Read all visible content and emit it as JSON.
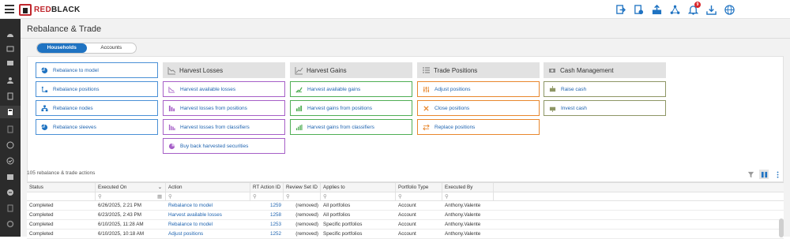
{
  "app": {
    "brand_red": "RED",
    "brand_black": "BLACK",
    "title": "Rebalance & Trade"
  },
  "top_icons": [
    "trade-icon",
    "reports-icon",
    "upload-icon",
    "network-icon",
    "bell-icon",
    "download-icon",
    "globe-icon"
  ],
  "notifications_count": "9",
  "left_nav": [
    "dashboard-icon",
    "portfolio-icon",
    "household-icon",
    "users-icon",
    "rebalance-icon",
    "document-icon",
    "model-icon",
    "check-icon",
    "calendar-icon",
    "minus-circle-icon",
    "file-icon",
    "settings-icon"
  ],
  "toggle": {
    "households": "Households",
    "accounts": "Accounts"
  },
  "groups": {
    "rebalance": {
      "items": [
        "Rebalance to model",
        "Rebalance positions",
        "Rebalance nodes",
        "Rebalance sleeves"
      ]
    },
    "harvest_losses": {
      "title": "Harvest Losses",
      "items": [
        "Harvest available losses",
        "Harvest losses from positions",
        "Harvest losses from classifiers",
        "Buy back harvested securities"
      ]
    },
    "harvest_gains": {
      "title": "Harvest Gains",
      "items": [
        "Harvest available gains",
        "Harvest gains from positions",
        "Harvest gains from classifiers"
      ]
    },
    "trade_positions": {
      "title": "Trade Positions",
      "items": [
        "Adjust positions",
        "Close positions",
        "Replace positions"
      ]
    },
    "cash_management": {
      "title": "Cash Management",
      "items": [
        "Raise cash",
        "Invest cash"
      ]
    }
  },
  "table": {
    "count_label": "105 rebalance & trade actions",
    "columns": [
      "Status",
      "Executed On",
      "Action",
      "RT Action ID",
      "Review Set ID",
      "Applies to",
      "Portfolio Type",
      "Executed By"
    ],
    "rows": [
      {
        "status": "Completed",
        "executed_on": "6/26/2025, 2:21 PM",
        "action": "Rebalance to model",
        "rt_id": "1259",
        "review": "(removed)",
        "applies": "All portfolios",
        "ptype": "Account",
        "by": "Anthony.Valente"
      },
      {
        "status": "Completed",
        "executed_on": "6/23/2025, 2:43 PM",
        "action": "Harvest available losses",
        "rt_id": "1258",
        "review": "(removed)",
        "applies": "All portfolios",
        "ptype": "Account",
        "by": "Anthony.Valente"
      },
      {
        "status": "Completed",
        "executed_on": "6/10/2025, 11:28 AM",
        "action": "Rebalance to model",
        "rt_id": "1253",
        "review": "(removed)",
        "applies": "Specific portfolios",
        "ptype": "Account",
        "by": "Anthony.Valente"
      },
      {
        "status": "Completed",
        "executed_on": "6/10/2025, 10:18 AM",
        "action": "Adjust positions",
        "rt_id": "1252",
        "review": "(removed)",
        "applies": "Specific portfolios",
        "ptype": "Account",
        "by": "Anthony.Valente"
      }
    ]
  },
  "colors": {
    "accent": "#1f73c2",
    "rebalance": "#4a90d6",
    "losses": "#a65fc7",
    "gains": "#4fae54",
    "trade": "#e8872d",
    "cash": "#8e9665",
    "nav_bg": "#2b2b2b"
  }
}
